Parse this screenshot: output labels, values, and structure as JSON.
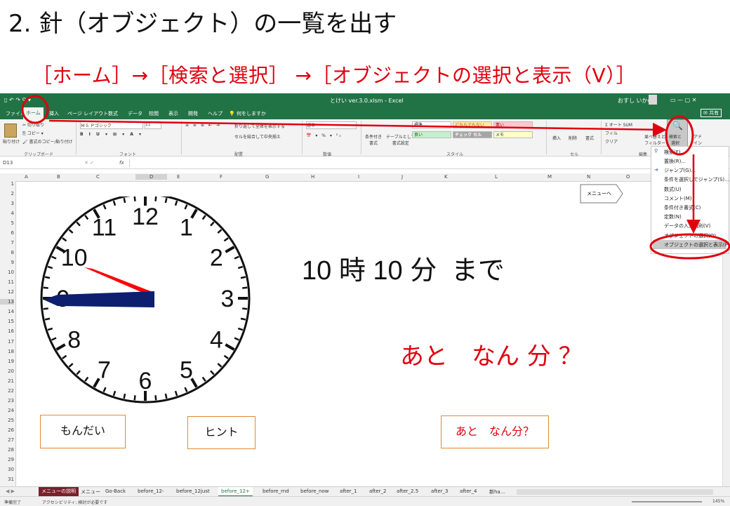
{
  "slide": {
    "title": "2. 針（オブジェクト）の一覧を出す",
    "path": "［ホーム］→［検索と選択］ →［オブジェクトの選択と表示（V）］"
  },
  "excel": {
    "quick_access": "▯ ↶ ↷ ⚲ ▾",
    "window_title": "とけい ver.3.0.xlsm  -  Excel",
    "user": "おすし いかの",
    "window_controls": "▭  —  ▢  ✕",
    "tabs": [
      "ファイル",
      "ホーム",
      "挿入",
      "ページ レイアウト",
      "数式",
      "データ",
      "校閲",
      "表示",
      "開発",
      "ヘルプ",
      "💡 何をしますか"
    ],
    "share": "✉ 共有",
    "ribbon": {
      "cut": "✂ 切り取り",
      "copy": "⎘ コピー ▾",
      "format_painter": "🖌 書式のコピー/貼り付け",
      "paste": "貼り付け",
      "clipboard_group": "クリップボード",
      "font_name": "ＭＳ Ｐゴシック",
      "font_size": "11",
      "font_group": "フォント",
      "wrap": "折り返して全体を表示する",
      "merge": "セルを結合して中央揃え",
      "align_group": "配置",
      "number_format": "標準",
      "number_group": "数値",
      "cond_format": "条件付き\n書式",
      "table_format": "テーブルとして\n書式設定",
      "styles": [
        "標準",
        "どちらでもない",
        "悪い",
        "良い",
        "チェック セル",
        "メモ"
      ],
      "style_group": "スタイル",
      "insert": "挿入",
      "delete": "削除",
      "format": "書式",
      "cells_group": "セル",
      "autosum": "Σ オート SUM",
      "fill": "フィル",
      "clear": "クリア",
      "sort_filter": "並べ替えと\nフィルター",
      "find_select": "検索と\n選択",
      "addin": "アド\nイン",
      "edit_group": "編集"
    },
    "name_box": "D13",
    "fx": "fx",
    "columns": [
      "A",
      "B",
      "C",
      "D",
      "E",
      "F",
      "G",
      "H",
      "I",
      "J",
      "K",
      "L",
      "M",
      "N",
      "O"
    ],
    "rows": [
      "1",
      "2",
      "3",
      "4",
      "5",
      "6",
      "7",
      "8",
      "9",
      "10",
      "11",
      "12",
      "13",
      "14",
      "15",
      "16",
      "17",
      "18",
      "19",
      "20",
      "21",
      "22",
      "23",
      "24",
      "25",
      "26",
      "27",
      "28",
      "29",
      "30",
      "31"
    ],
    "sheet_tabs": [
      "メニューの説明",
      "メニュー",
      "Go-Back",
      "before_12-",
      "before_12just",
      "before_12+",
      "before_rnd",
      "before_now",
      "after_1",
      "after_2",
      "after_2.5",
      "after_3",
      "after_4",
      "新ha..."
    ],
    "active_sheet": "before_12+",
    "status_ready": "準備完了",
    "status_accessibility": "アクセシビリティ: 検討が必要です",
    "zoom": "145%"
  },
  "clock": {
    "numbers": [
      "12",
      "1",
      "2",
      "3",
      "4",
      "5",
      "6",
      "7",
      "8",
      "9",
      "10",
      "11"
    ],
    "hour_hand_color": "#ff0000",
    "minute_hand_color": "#0d1f6e"
  },
  "content": {
    "time_hour": "10",
    "time_hour_unit": "時",
    "time_min": "10",
    "time_min_unit": "分",
    "made": "まで",
    "remaining": "あと　なん 分 ？",
    "btn_question": "もんだい",
    "btn_hint": "ヒント",
    "btn_answer": "あと　なん分？",
    "menu_btn": "メニューへ"
  },
  "dropdown": {
    "items": [
      "検索(F)...",
      "置換(R)...",
      "ジャンプ(G)...",
      "条件を選択してジャンプ(S)...",
      "数式(U)",
      "コメント(M)",
      "条件付き書式(C)",
      "定数(N)",
      "データの入力規則(V)",
      "オブジェクトの選択(O)",
      "オブジェクトの選択と表示(P)..."
    ]
  },
  "colors": {
    "excel_green": "#217346",
    "annotation_red": "#e0000e",
    "button_border": "#e08a33"
  }
}
